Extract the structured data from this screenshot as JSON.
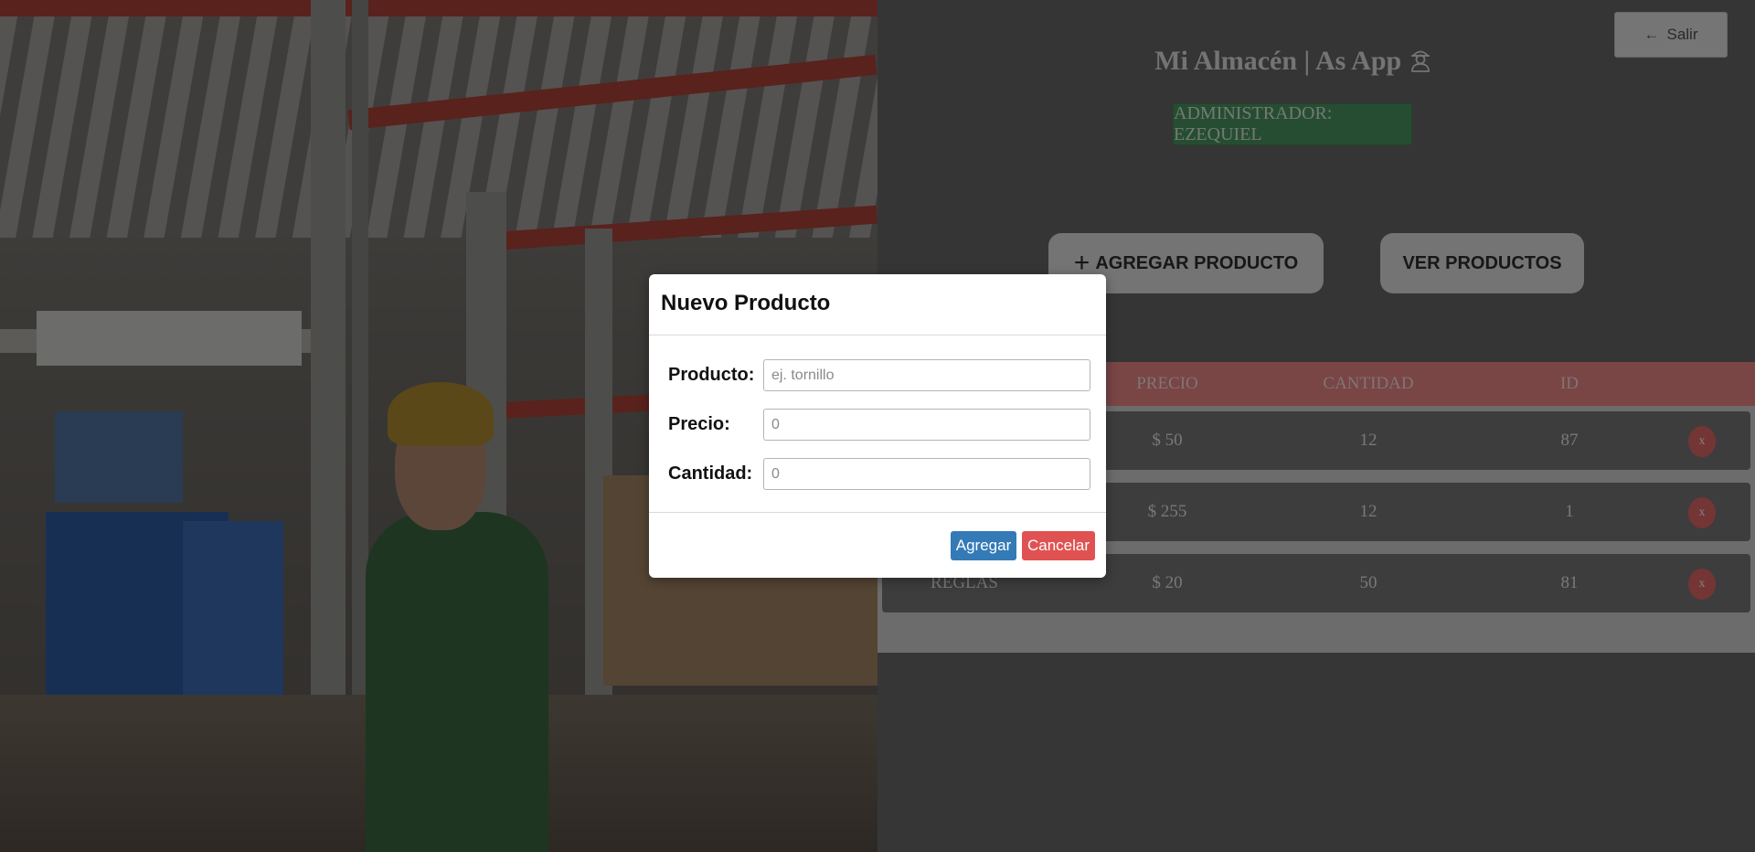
{
  "header": {
    "exit_label": "Salir",
    "exit_icon": "arrow-left-icon",
    "title": "Mi Almacén | As App",
    "title_icon": "worker-icon",
    "admin_badge": "ADMINISTRADOR: EZEQUIEL"
  },
  "actions": {
    "add_icon": "+",
    "add_label": "AGREGAR PRODUCTO",
    "view_label": "VER PRODUCTOS"
  },
  "table": {
    "columns": [
      "PRECIO",
      "CANTIDAD",
      "ID"
    ],
    "rows": [
      {
        "name": "",
        "price": "$ 50",
        "quantity": "12",
        "id": "87",
        "delete": "x"
      },
      {
        "name": "",
        "price": "$ 255",
        "quantity": "12",
        "id": "1",
        "delete": "x"
      },
      {
        "name": "REGLAS",
        "price": "$ 20",
        "quantity": "50",
        "id": "81",
        "delete": "x"
      }
    ]
  },
  "modal": {
    "title": "Nuevo Producto",
    "fields": [
      {
        "label": "Producto:",
        "value": "",
        "placeholder": "ej. tornillo"
      },
      {
        "label": "Precio:",
        "value": "",
        "placeholder": "0"
      },
      {
        "label": "Cantidad:",
        "value": "",
        "placeholder": "0"
      }
    ],
    "submit_label": "Agregar",
    "cancel_label": "Cancelar"
  },
  "colors": {
    "admin_badge": "#4c9b63",
    "table_header": "#f28b8b",
    "delete_button": "#e86a6a",
    "primary_button": "#337ab7",
    "danger_button": "#e05252"
  }
}
